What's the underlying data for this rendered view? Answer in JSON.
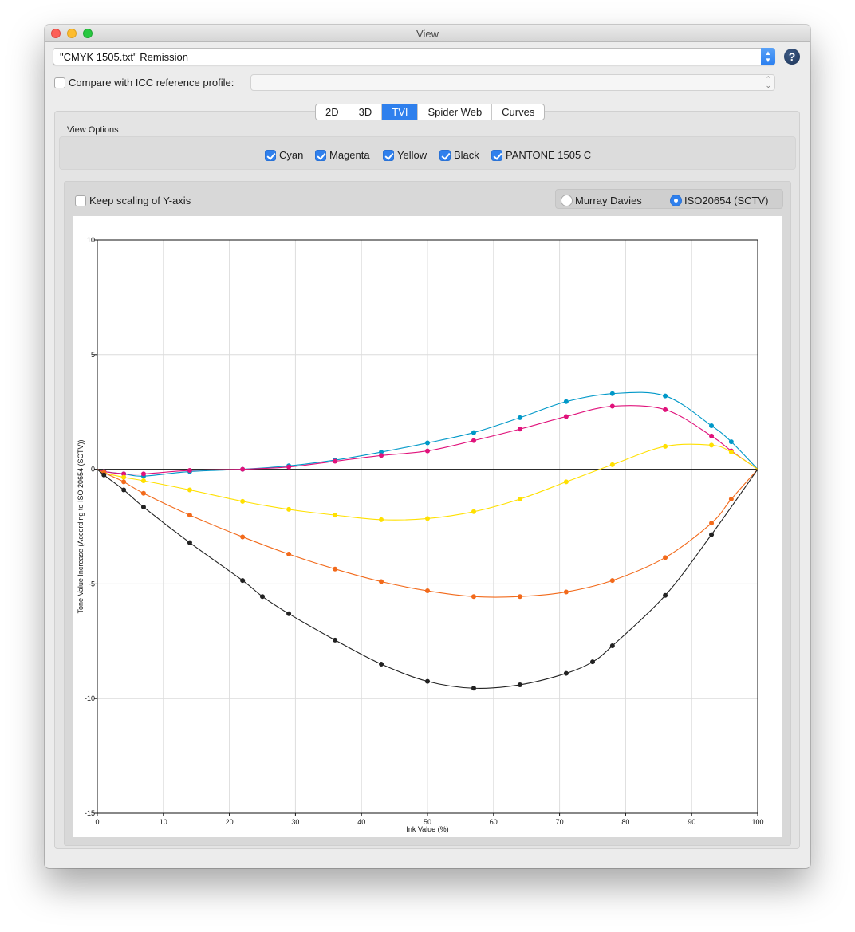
{
  "window": {
    "title": "View"
  },
  "source_popup": {
    "value": "\"CMYK 1505.txt\" Remission"
  },
  "help": {
    "label": "?"
  },
  "compare": {
    "label": "Compare with ICC reference profile:",
    "checked": false,
    "reference_value": ""
  },
  "tabs": [
    {
      "label": "2D",
      "active": false
    },
    {
      "label": "3D",
      "active": false
    },
    {
      "label": "TVI",
      "active": true
    },
    {
      "label": "Spider Web",
      "active": false
    },
    {
      "label": "Curves",
      "active": false
    }
  ],
  "view_options": {
    "heading": "View Options",
    "items": [
      {
        "label": "Cyan",
        "checked": true
      },
      {
        "label": "Magenta",
        "checked": true
      },
      {
        "label": "Yellow",
        "checked": true
      },
      {
        "label": "Black",
        "checked": true
      },
      {
        "label": "PANTONE 1505 C",
        "checked": true
      }
    ]
  },
  "keep_scaling": {
    "label": "Keep scaling of Y-axis",
    "checked": false
  },
  "tvi_method": {
    "options": [
      {
        "label": "Murray Davies",
        "selected": false
      },
      {
        "label": "ISO20654 (SCTV)",
        "selected": true
      }
    ]
  },
  "chart_data": {
    "type": "line",
    "xlabel": "Ink Value (%)",
    "ylabel": "Tone Value Increase (According to ISO 20654 (SCTV))",
    "xlim": [
      0,
      100
    ],
    "ylim": [
      -15,
      10
    ],
    "x_ticks": [
      "0",
      "10",
      "20",
      "30",
      "40",
      "50",
      "60",
      "70",
      "80",
      "90",
      "100"
    ],
    "y_ticks": [
      "10",
      "5",
      "0",
      "-5",
      "-10",
      "-15"
    ],
    "grid": true,
    "series": [
      {
        "color": "#0098c8",
        "x": [
          0,
          1,
          4,
          7,
          14,
          22,
          29,
          36,
          43,
          50,
          57,
          64,
          71,
          78,
          86,
          93,
          96,
          100
        ],
        "y": [
          0,
          -0.1,
          -0.2,
          -0.3,
          -0.1,
          0.0,
          0.15,
          0.4,
          0.75,
          1.15,
          1.6,
          2.25,
          2.95,
          3.3,
          3.2,
          1.9,
          1.2,
          0
        ]
      },
      {
        "color": "#e0127b",
        "x": [
          0,
          1,
          4,
          7,
          14,
          22,
          29,
          36,
          43,
          50,
          57,
          64,
          71,
          78,
          86,
          93,
          96,
          100
        ],
        "y": [
          0,
          -0.1,
          -0.2,
          -0.2,
          -0.05,
          0.0,
          0.1,
          0.35,
          0.6,
          0.8,
          1.25,
          1.75,
          2.3,
          2.75,
          2.6,
          1.45,
          0.8,
          0
        ]
      },
      {
        "color": "#ffe000",
        "x": [
          0,
          1,
          4,
          7,
          14,
          22,
          29,
          36,
          43,
          50,
          57,
          64,
          71,
          78,
          86,
          93,
          96,
          100
        ],
        "y": [
          0,
          -0.15,
          -0.35,
          -0.5,
          -0.9,
          -1.4,
          -1.75,
          -2.0,
          -2.2,
          -2.15,
          -1.85,
          -1.3,
          -0.55,
          0.2,
          1.0,
          1.05,
          0.75,
          0
        ]
      },
      {
        "color": "#f26a1b",
        "x": [
          0,
          1,
          4,
          7,
          14,
          22,
          29,
          36,
          43,
          50,
          57,
          64,
          71,
          78,
          86,
          93,
          96,
          100
        ],
        "y": [
          0,
          -0.15,
          -0.55,
          -1.05,
          -2.0,
          -2.95,
          -3.7,
          -4.35,
          -4.9,
          -5.3,
          -5.55,
          -5.55,
          -5.35,
          -4.85,
          -3.85,
          -2.35,
          -1.3,
          0
        ]
      },
      {
        "color": "#222222",
        "x": [
          0,
          1,
          4,
          7,
          14,
          22,
          25,
          29,
          36,
          43,
          50,
          57,
          64,
          71,
          75,
          78,
          86,
          93,
          100
        ],
        "y": [
          0,
          -0.25,
          -0.9,
          -1.65,
          -3.2,
          -4.85,
          -5.55,
          -6.3,
          -7.45,
          -8.5,
          -9.25,
          -9.55,
          -9.4,
          -8.9,
          -8.4,
          -7.7,
          -5.5,
          -2.85,
          0
        ]
      }
    ]
  }
}
